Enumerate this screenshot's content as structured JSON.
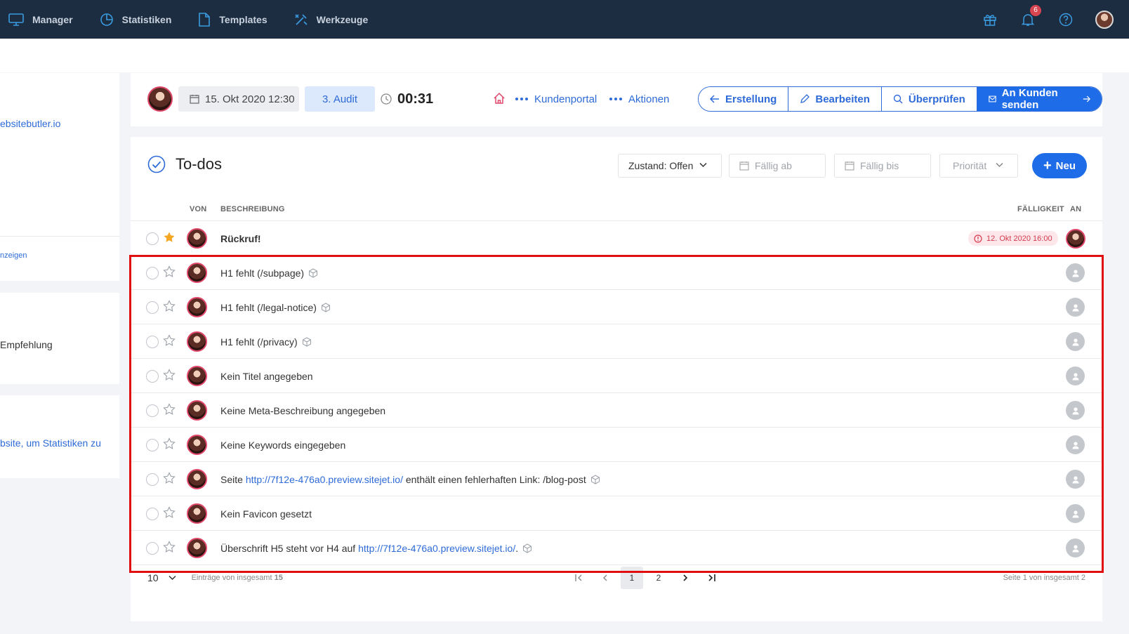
{
  "nav": {
    "items": [
      {
        "label": "Manager",
        "icon": "monitor-icon"
      },
      {
        "label": "Statistiken",
        "icon": "pie-chart-icon"
      },
      {
        "label": "Templates",
        "icon": "document-icon"
      },
      {
        "label": "Werkzeuge",
        "icon": "tools-icon"
      }
    ],
    "notification_count": "6"
  },
  "left_panel": {
    "email_fragment": "ebsitebutler.io",
    "link_fragment": "nzeigen",
    "recommendation_fragment": "Empfehlung",
    "stats_fragment": "bsite, um Statistiken zu"
  },
  "header": {
    "date": "15. Okt 2020 12:30",
    "audit": "3. Audit",
    "timer": "00:31",
    "kundenportal": "Kundenportal",
    "aktionen": "Aktionen",
    "buttons": {
      "erstellung": "Erstellung",
      "bearbeiten": "Bearbeiten",
      "ueberpruefen": "Überprüfen",
      "send": "An Kunden senden"
    }
  },
  "todos": {
    "title": "To-dos",
    "filters": {
      "state": "Zustand: Offen",
      "due_from": "Fällig ab",
      "due_to": "Fällig bis",
      "priority": "Priorität"
    },
    "new_button": "Neu",
    "columns": {
      "from": "VON",
      "description": "BESCHREIBUNG",
      "due": "FÄLLIGKEIT",
      "to": "AN"
    },
    "rows": [
      {
        "text": "Rückruf!",
        "starred": true,
        "bold": true,
        "due": "12. Okt 2020 16:00"
      },
      {
        "text": "H1 fehlt (/subpage)",
        "cube": true
      },
      {
        "text": "H1 fehlt (/legal-notice)",
        "cube": true
      },
      {
        "text": "H1 fehlt (/privacy)",
        "cube": true
      },
      {
        "text": "Kein Titel angegeben"
      },
      {
        "text": "Keine Meta-Beschreibung angegeben"
      },
      {
        "text": "Keine Keywords eingegeben"
      },
      {
        "prefix": "Seite ",
        "link": "http://7f12e-476a0.preview.sitejet.io/",
        "suffix": " enthält einen fehlerhaften Link: /blog-post",
        "cube": true
      },
      {
        "text": "Kein Favicon gesetzt"
      },
      {
        "prefix": "Überschrift H5 steht vor H4 auf ",
        "link": "http://7f12e-476a0.preview.sitejet.io/",
        "suffix": ".",
        "cube": true
      }
    ],
    "pagination": {
      "page_size": "10",
      "entries_text": "Einträge von insgesamt",
      "entries_total": "15",
      "pages": [
        "1",
        "2"
      ],
      "current_page": "1",
      "page_info": "Seite 1 von insgesamt 2"
    }
  },
  "colors": {
    "nav_bg": "#1c2d42",
    "primary": "#1f6ce8",
    "danger": "#d43a4d",
    "highlight": "#e01010"
  }
}
